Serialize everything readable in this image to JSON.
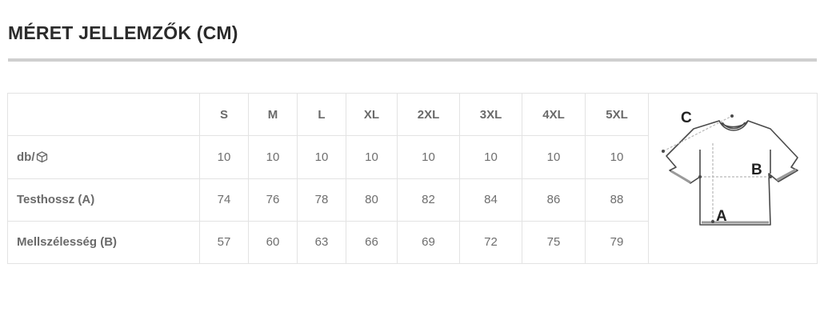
{
  "title": "MÉRET JELLEMZŐK (CM)",
  "table": {
    "columns": [
      "S",
      "M",
      "L",
      "XL",
      "2XL",
      "3XL",
      "4XL",
      "5XL"
    ],
    "rows": [
      {
        "label": "db/",
        "icon": "box-icon",
        "values": [
          "10",
          "10",
          "10",
          "10",
          "10",
          "10",
          "10",
          "10"
        ]
      },
      {
        "label": "Testhossz (A)",
        "values": [
          "74",
          "76",
          "78",
          "80",
          "82",
          "84",
          "86",
          "88"
        ]
      },
      {
        "label": "Mellszélesség (B)",
        "values": [
          "57",
          "60",
          "63",
          "66",
          "69",
          "72",
          "75",
          "79"
        ]
      }
    ]
  },
  "diagram": {
    "labels": [
      "C",
      "B",
      "A"
    ],
    "icon": "tshirt-icon"
  }
}
